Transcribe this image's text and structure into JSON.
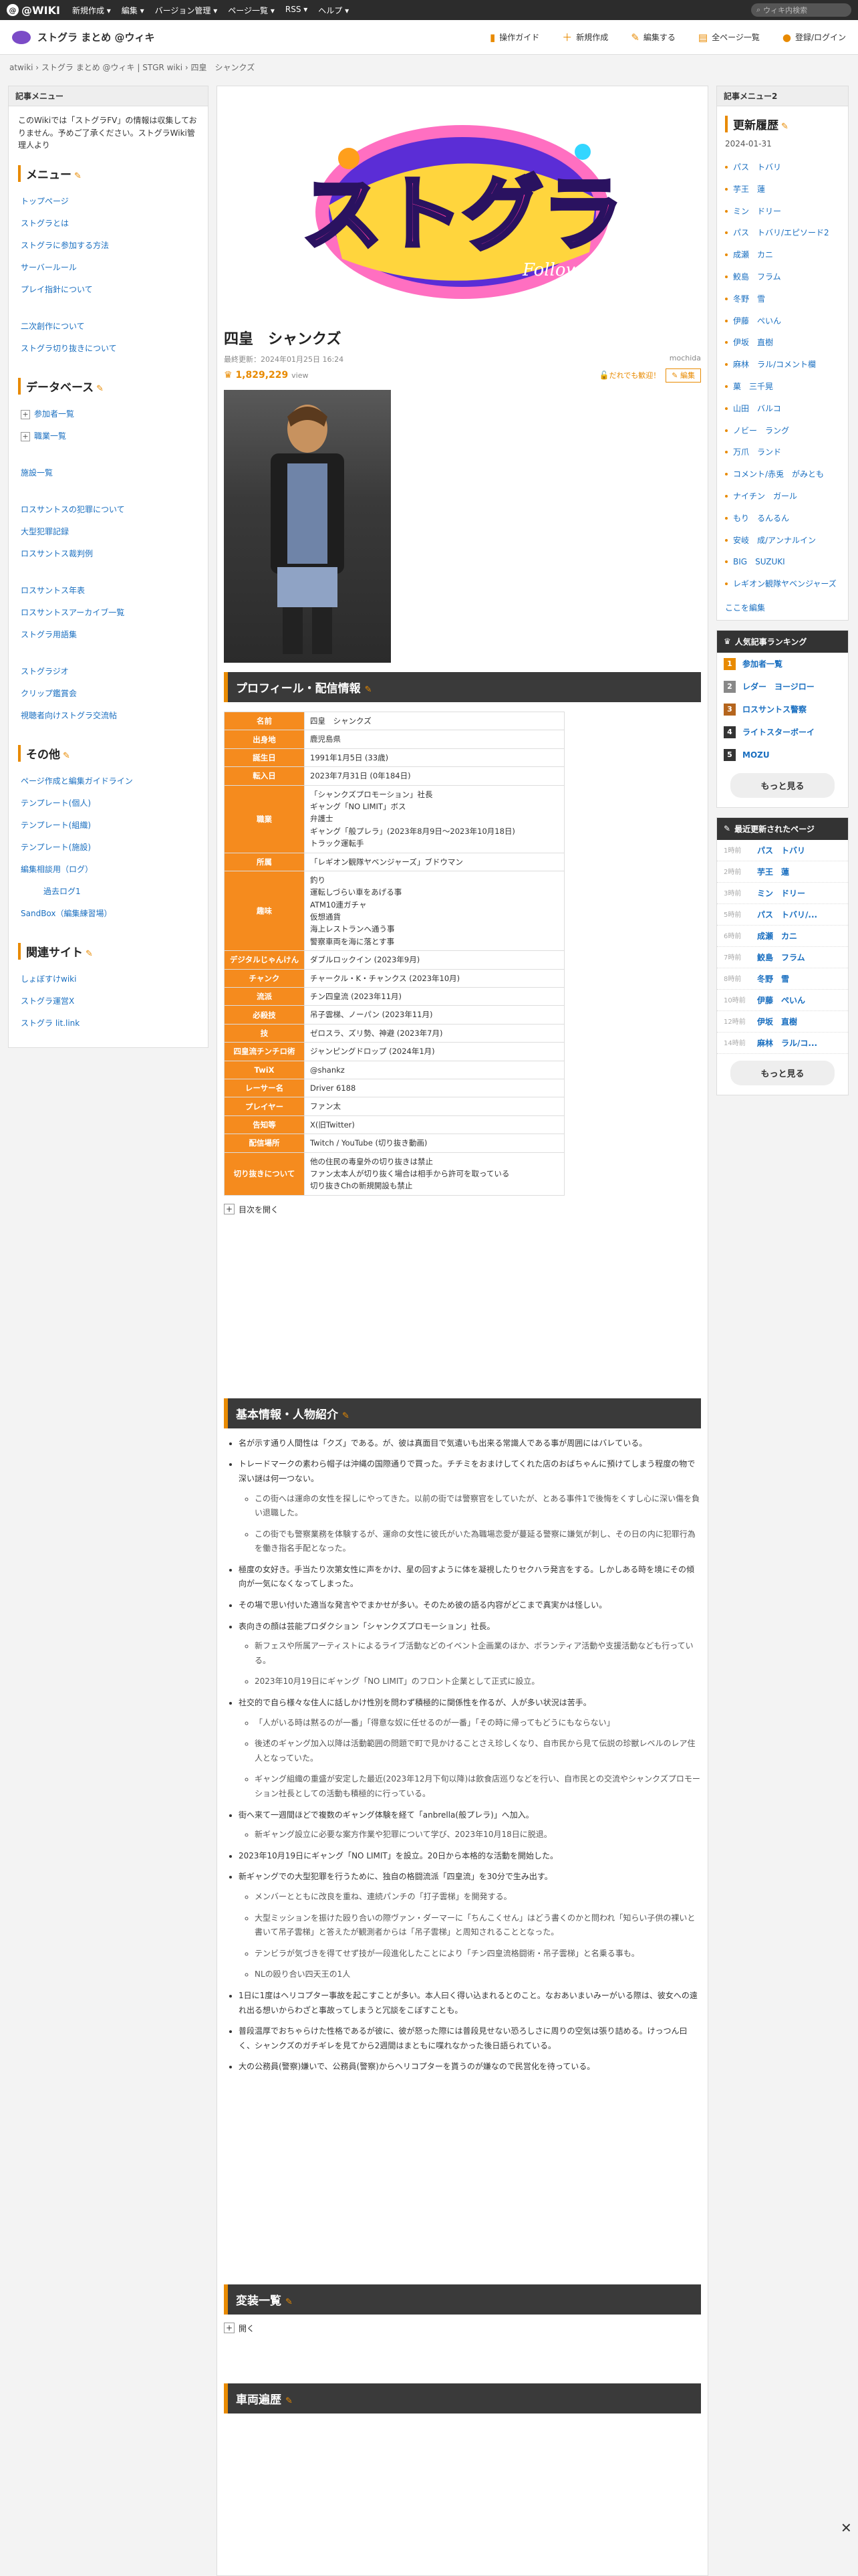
{
  "topbar": {
    "logo": "@WIKI",
    "nav": [
      "新規作成 ▾",
      "編集 ▾",
      "バージョン管理 ▾",
      "ページ一覧 ▾",
      "RSS ▾",
      "ヘルプ ▾"
    ],
    "search_placeholder": "ウィキ内検索"
  },
  "site": {
    "name": "ストグラ まとめ @ウィキ",
    "actions": [
      "操作ガイド",
      "新規作成",
      "編集する",
      "全ページ一覧",
      "登録/ログイン"
    ]
  },
  "breadcrumb": "atwiki › ストグラ まとめ @ウィキ | STGR wiki › 四皇　シャンクズ",
  "left": {
    "head": "記事メニュー",
    "intro": "このWikiでは「ストグラFV」の情報は収集しておりません。予めご了承ください。ストグラWiki管理人より",
    "menu_title": "メニュー",
    "menu": [
      "トップページ",
      "ストグラとは",
      "ストグラに参加する方法",
      "サーバールール",
      "プレイ指針について",
      "",
      "二次創作について",
      "ストグラ切り抜きについて"
    ],
    "db_title": "データベース",
    "db": [
      "参加者一覧",
      "職業一覧",
      "",
      "施設一覧",
      "",
      "ロスサントスの犯罪について",
      "大型犯罪記録",
      "ロスサントス裁判例",
      "",
      "ロスサントス年表",
      "ロスサントスアーカイブ一覧",
      "ストグラ用語集",
      "",
      "ストグラジオ",
      "クリップ鑑賞会",
      "視聴者向けストグラ交流帖"
    ],
    "other_title": "その他",
    "other": [
      "ページ作成と編集ガイドライン",
      "テンプレート(個人)",
      "テンプレート(組織)",
      "テンプレート(施設)",
      "編集相談用（ログ）",
      "過去ログ1",
      "SandBox（編集練習場）"
    ],
    "links_title": "関連サイト",
    "links": [
      "しょぼすけwiki",
      "ストグラ運営X",
      "ストグラ lit.link"
    ]
  },
  "article": {
    "banner_text": "ストグラ",
    "banner_sub": "Follow Me",
    "title": "四皇　シャンクズ",
    "updated": "最終更新：2024年01月25日 16:24",
    "author": "mochida",
    "views": "1,829,229",
    "views_unit": "view",
    "anyone_edit": "だれでも歓迎！",
    "edit_btn": "編集",
    "profile_title": "プロフィール・配信情報",
    "profile": [
      {
        "k": "名前",
        "v": "四皇　シャンクズ"
      },
      {
        "k": "出身地",
        "v": "鹿児島県"
      },
      {
        "k": "誕生日",
        "v": "1991年1月5日 (33歳)"
      },
      {
        "k": "転入日",
        "v": "2023年7月31日 (0年184日)"
      },
      {
        "k": "職業",
        "v": "「シャンクズプロモーション」社長\nギャング「NO LIMIT」ボス\n弁護士\nギャング「般プレラ」(2023年8月9日〜2023年10月18日)\nトラック運転手"
      },
      {
        "k": "所属",
        "v": "「レギオン観隊ヤベンジャーズ」ブドウマン"
      },
      {
        "k": "趣味",
        "v": "釣り\n運転しづらい車をあげる事\nATM10連ガチャ\n仮想通貨\n海上レストランへ通う事\n警察車両を海に落とす事"
      },
      {
        "k": "デジタルじゃんけん",
        "v": "ダブルロックイン (2023年9月)"
      },
      {
        "k": "チャンク",
        "v": "チャークル・K・チャンクス (2023年10月)"
      },
      {
        "k": "流派",
        "v": "チン四皇流 (2023年11月)"
      },
      {
        "k": "必殺技",
        "v": "吊子雲梯、ノーパン (2023年11月)"
      },
      {
        "k": "技",
        "v": "ゼロスラ、ズリ勢、神避 (2023年7月)"
      },
      {
        "k": "四皇流チンチロ術",
        "v": "ジャンピングドロップ (2024年1月)"
      },
      {
        "k": "TwiX",
        "v": "@shankz"
      },
      {
        "k": "レーサー名",
        "v": "Driver 6188"
      },
      {
        "k": "プレイヤー",
        "v": "ファン太"
      },
      {
        "k": "告知等",
        "v": "X(旧Twitter)"
      },
      {
        "k": "配信場所",
        "v": "Twitch / YouTube (切り抜き動画)"
      },
      {
        "k": "切り抜きについて",
        "v": "他の住民の毒皇外の切り抜きは禁止\nファン太本人が切り抜く場合は相手から許可を取っている\n切り抜きChの新規開設も禁止"
      }
    ],
    "toc": "目次を開く",
    "basic_title": "基本情報・人物紹介",
    "basic": [
      "名が示す通り人間性は「クズ」である。が、彼は真面目で気遣いも出来る常識人である事が周囲にはバレている。",
      "トレードマークの素わら帽子は沖縄の国際通りで買った。チチミをおまけしてくれた店のおばちゃんに預けてしまう程度の物で深い謎は何一つない。",
      "この街へは運命の女性を探しにやってきた。以前の街では警察官をしていたが、とある事件1で後悔をくすし心に深い傷を負い退職した。",
      "この街でも警察業務を体験するが、運命の女性に彼氏がいた為職場恋愛が蔓延る警察に嫌気が刺し、その日の内に犯罪行為を働き指名手配となった。",
      "極度の女好き。手当たり次第女性に声をかけ、星の回すように体を凝視したりセクハラ発言をする。しかしある時を境にその傾向が一気になくなってしまった。",
      "その場で思い付いた適当な発言やでまかせが多い。そのため彼の語る内容がどこまで真実かは怪しい。",
      "表向きの顔は芸能プロダクション「シャンクズプロモーション」社長。",
      "新フェスや所属アーティストによるライブ活動などのイベント企画業のほか、ボランティア活動や支援活動なども行っている。",
      "2023年10月19日にギャング「NO LIMIT」のフロント企業として正式に設立。",
      "社交的で自ら様々な住人に話しかけ性別を問わず積極的に関係性を作るが、人が多い状況は苦手。",
      "「人がいる時は黙るのが一番」「得意な奴に任せるのが一番」「その時に帰ってもどうにもならない」",
      "後述のギャング加入以降は活動範囲の問題で町で見かけることさえ珍しくなり、自市民から見て伝説の珍獣レベルのレア住人となっていた。",
      "ギャング組織の重盛が安定した最近(2023年12月下旬以降)は飲食店巡りなどを行い、自市民との交流やシャンクズプロモーション社長としての活動も積極的に行っている。",
      "街へ来て一週間ほどで複数のギャング体験を経て「anbrella(般プレラ)」へ加入。",
      "新ギャング設立に必要な案方作業や犯罪について学び、2023年10月18日に脱退。",
      "2023年10月19日にギャング「NO LIMIT」を設立。20日から本格的な活動を開始した。",
      "新ギャングでの大型犯罪を行うために、独自の格闘流派「四皇流」を30分で生み出す。",
      "メンバーとともに改良を重ね、連続パンチの「打子雲梯」を開発する。",
      "大型ミッションを振けた殴り合いの際ヴァン・ダーマーに「ちんこくせん」はどう書くのかと問われ「知らい子供の裸いと書いて吊子雲梯」と答えたが観測者からは「吊子雲梯」と周知されることとなった。",
      "テンビラが気づきを得てせず技が一段進化したことにより「チン四皇流格闘術・吊子雲梯」と名乗る事も。",
      "NLの殴り合い四天王の1人",
      "1日に1度はヘリコプター事故を起こすことが多い。本人曰く得い込まれるとのこと。なおあいまいみーがいる際は、彼女への遠れ出る想いからわざと事故ってしまうと冗談をこぼすことも。",
      "普段温厚でおちゃらけた性格であるが彼に、彼が怒った際には普段見せない恐ろしさに周りの空気は張り詰める。けっつん曰く、シャンクズのガチギレを見てから2週間はまともに喋れなかった後日語られている。",
      "大の公務員(警察)嫌いで、公務員(警察)からヘリコプターを貰うのが嫌なので民営化を待っている。"
    ],
    "costume_title": "変装一覧",
    "costume_open": "開く",
    "vehicle_title": "車両遍歴"
  },
  "right": {
    "head": "記事メニュー2",
    "history_title": "更新履歴",
    "date": "2024-01-31",
    "history": [
      "パス　トバリ",
      "芋王　蓮",
      "ミン　ドリー",
      "パス　トバリ/エピソード2",
      "成瀬　カニ",
      "鮫島　フラム",
      "冬野　雪",
      "伊藤　ぺいん",
      "伊坂　直樹",
      "麻林　ラル/コメント欄",
      "菓　三千晃",
      "山田　バルコ",
      "ノビー　ラング",
      "万爪　ランド",
      "コメント/赤兎　がみとも",
      "ナイチン　ガール",
      "もり　るんるん",
      "安岐　成/アンナルイン",
      "BIG　SUZUKI",
      "レギオン観隊ヤベンジャーズ"
    ],
    "more_edit": "ここを編集",
    "ranking_title": "人気記事ランキング",
    "ranking": [
      "参加者一覧",
      "レダー　ヨージロー",
      "ロスサントス警察",
      "ライトスターボーイ",
      "MOZU"
    ],
    "ranking_colors": [
      "#e88a00",
      "#888888",
      "#b5651d",
      "#333333",
      "#333333"
    ],
    "more": "もっと見る",
    "recent_title": "最近更新されたページ",
    "recent": [
      {
        "t": "1時前",
        "n": "パス　トバリ"
      },
      {
        "t": "2時前",
        "n": "芋王　蓮"
      },
      {
        "t": "3時前",
        "n": "ミン　ドリー"
      },
      {
        "t": "5時前",
        "n": "パス　トバリ/..."
      },
      {
        "t": "6時前",
        "n": "成瀬　カニ"
      },
      {
        "t": "7時前",
        "n": "鮫島　フラム"
      },
      {
        "t": "8時前",
        "n": "冬野　雪"
      },
      {
        "t": "10時前",
        "n": "伊藤　ぺいん"
      },
      {
        "t": "12時前",
        "n": "伊坂　直樹"
      },
      {
        "t": "14時前",
        "n": "麻林　ラル/コ..."
      }
    ],
    "more2": "もっと見る"
  }
}
